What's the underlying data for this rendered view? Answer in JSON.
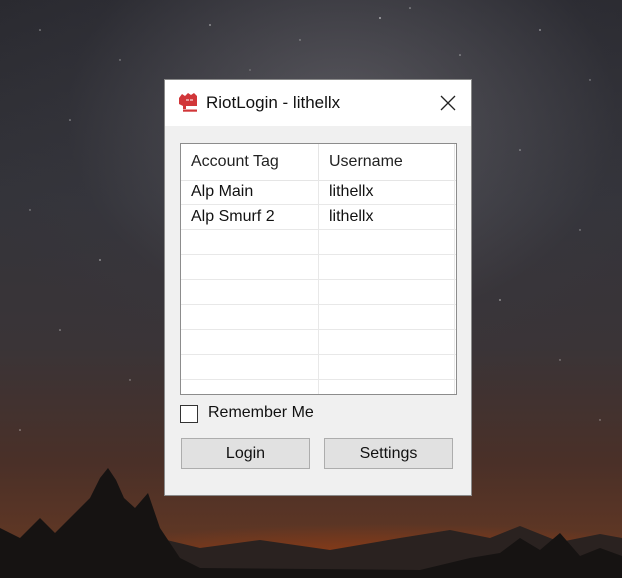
{
  "window": {
    "title": "RiotLogin - lithellx",
    "icon": "riot-fist-icon",
    "close": "close-icon"
  },
  "table": {
    "columns": [
      "Account Tag",
      "Username"
    ],
    "rows": [
      {
        "account_tag": "Alp Main",
        "username": "lithellx"
      },
      {
        "account_tag": "Alp Smurf 2",
        "username": "lithellx"
      }
    ]
  },
  "remember_me": {
    "label": "Remember Me",
    "checked": false
  },
  "buttons": {
    "login": "Login",
    "settings": "Settings"
  },
  "colors": {
    "brand_red": "#d13639",
    "window_bg": "#f0f0f0",
    "button_bg": "#e1e1e1"
  }
}
